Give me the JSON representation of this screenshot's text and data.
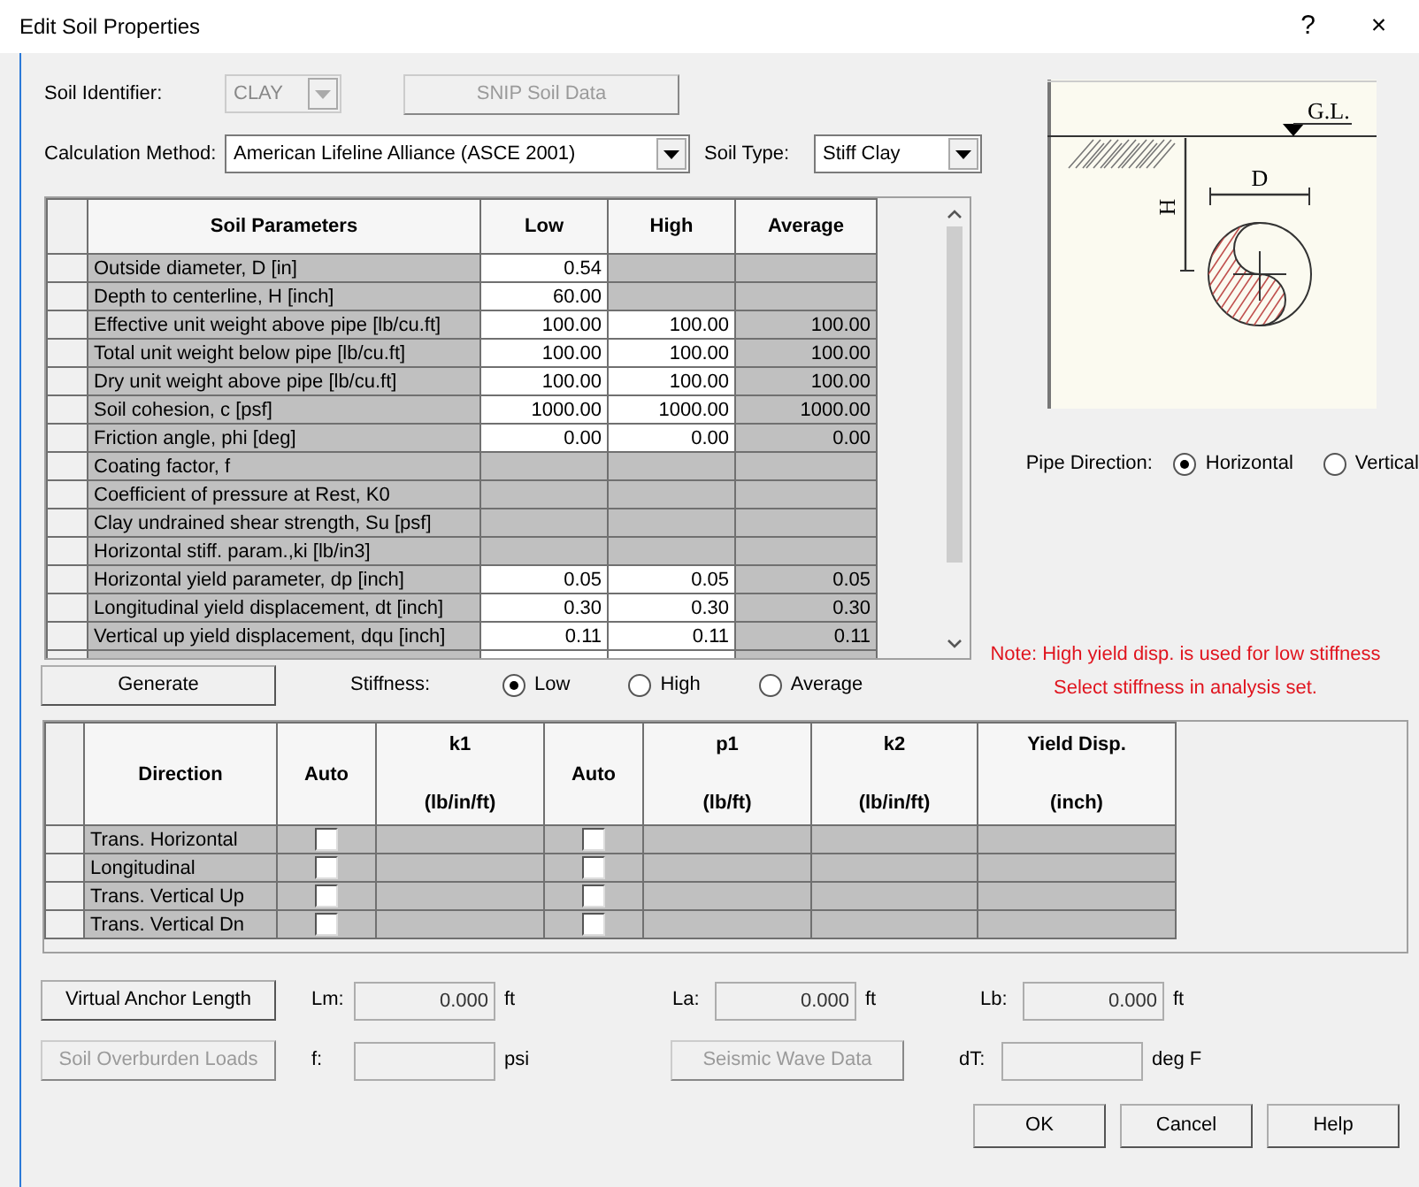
{
  "window": {
    "title": "Edit Soil Properties",
    "help_button": "?",
    "close_button": "×"
  },
  "soil_identifier": {
    "label": "Soil Identifier:",
    "value": "CLAY",
    "disabled": true
  },
  "snip_button": {
    "label": "SNIP Soil Data",
    "disabled": true
  },
  "calculation_method": {
    "label": "Calculation Method:",
    "value": "American Lifeline Alliance (ASCE 2001)"
  },
  "soil_type": {
    "label": "Soil Type:",
    "value": "Stiff Clay"
  },
  "soil_table": {
    "columns": [
      "Soil Parameters",
      "Low",
      "High",
      "Average"
    ],
    "rows": [
      {
        "cells": [
          {
            "value": "Outside diameter, D  [in]",
            "editable": false
          },
          {
            "value": "0.54",
            "editable": true
          },
          {
            "editable": false
          },
          {
            "editable": false
          }
        ]
      },
      {
        "cells": [
          {
            "value": "Depth to centerline, H  [inch]",
            "editable": false
          },
          {
            "value": "60.00",
            "editable": true
          },
          {
            "editable": false
          },
          {
            "editable": false
          }
        ]
      },
      {
        "cells": [
          {
            "value": "Effective unit weight above pipe  [lb/cu.ft]",
            "editable": false
          },
          {
            "value": "100.00",
            "editable": true
          },
          {
            "value": "100.00",
            "editable": true
          },
          {
            "value": "100.00",
            "editable": false
          }
        ]
      },
      {
        "cells": [
          {
            "value": "Total unit weight below pipe  [lb/cu.ft]",
            "editable": false
          },
          {
            "value": "100.00",
            "editable": true
          },
          {
            "value": "100.00",
            "editable": true
          },
          {
            "value": "100.00",
            "editable": false
          }
        ]
      },
      {
        "cells": [
          {
            "value": "Dry unit weight above pipe  [lb/cu.ft]",
            "editable": false
          },
          {
            "value": "100.00",
            "editable": true
          },
          {
            "value": "100.00",
            "editable": true
          },
          {
            "value": "100.00",
            "editable": false
          }
        ]
      },
      {
        "cells": [
          {
            "value": "Soil cohesion, c  [psf]",
            "editable": false
          },
          {
            "value": "1000.00",
            "editable": true
          },
          {
            "value": "1000.00",
            "editable": true
          },
          {
            "value": "1000.00",
            "editable": false
          }
        ]
      },
      {
        "cells": [
          {
            "value": "Friction angle, phi  [deg]",
            "editable": false
          },
          {
            "value": "0.00",
            "editable": true
          },
          {
            "value": "0.00",
            "editable": true
          },
          {
            "value": "0.00",
            "editable": false
          }
        ]
      },
      {
        "cells": [
          {
            "value": "Coating factor, f",
            "editable": false
          },
          {
            "editable": false
          },
          {
            "editable": false
          },
          {
            "editable": false
          }
        ]
      },
      {
        "cells": [
          {
            "value": "Coefficient of pressure at Rest, K0",
            "editable": false
          },
          {
            "editable": false
          },
          {
            "editable": false
          },
          {
            "editable": false
          }
        ]
      },
      {
        "cells": [
          {
            "value": "Clay undrained shear strength, Su  [psf]",
            "editable": false
          },
          {
            "editable": false
          },
          {
            "editable": false
          },
          {
            "editable": false
          }
        ]
      },
      {
        "cells": [
          {
            "value": "Horizontal stiff. param.,ki [lb/in3]",
            "editable": false
          },
          {
            "editable": false
          },
          {
            "editable": false
          },
          {
            "editable": false
          }
        ]
      },
      {
        "cells": [
          {
            "value": "Horizontal yield parameter, dp  [inch]",
            "editable": false
          },
          {
            "value": "0.05",
            "editable": true
          },
          {
            "value": "0.05",
            "editable": true
          },
          {
            "value": "0.05",
            "editable": false
          }
        ]
      },
      {
        "cells": [
          {
            "value": "Longitudinal yield displacement, dt [inch]",
            "editable": false
          },
          {
            "value": "0.30",
            "editable": true
          },
          {
            "value": "0.30",
            "editable": true
          },
          {
            "value": "0.30",
            "editable": false
          }
        ]
      },
      {
        "cells": [
          {
            "value": "Vertical up yield displacement, dqu [inch]",
            "editable": false
          },
          {
            "value": "0.11",
            "editable": true
          },
          {
            "value": "0.11",
            "editable": true
          },
          {
            "value": "0.11",
            "editable": false
          }
        ]
      }
    ]
  },
  "diagram": {
    "ground_label": "G.L.",
    "diameter_label": "D",
    "depth_label": "H"
  },
  "pipe_direction": {
    "label": "Pipe Direction:",
    "options": [
      {
        "label": "Horizontal",
        "selected": true
      },
      {
        "label": "Vertical",
        "selected": false
      }
    ]
  },
  "note": [
    "Note: High yield disp. is used for low stiffness",
    "Select stiffness in analysis set."
  ],
  "generate_button": "Generate",
  "stiffness": {
    "label": "Stiffness:",
    "options": [
      {
        "label": "Low",
        "selected": true
      },
      {
        "label": "High",
        "selected": false
      },
      {
        "label": "Average",
        "selected": false
      }
    ]
  },
  "spring_table": {
    "columns": [
      {
        "title": "Direction"
      },
      {
        "title": "Auto"
      },
      {
        "title": "k1",
        "unit": "(lb/in/ft)"
      },
      {
        "title": "Auto"
      },
      {
        "title": "p1",
        "unit": "(lb/ft)"
      },
      {
        "title": "k2",
        "unit": "(lb/in/ft)"
      },
      {
        "title": "Yield Disp.",
        "unit": "(inch)"
      }
    ],
    "rows": [
      {
        "direction": "Trans. Horizontal",
        "auto_k1": false,
        "auto_p1": false
      },
      {
        "direction": "Longitudinal",
        "auto_k1": false,
        "auto_p1": false
      },
      {
        "direction": "Trans. Vertical Up",
        "auto_k1": false,
        "auto_p1": false
      },
      {
        "direction": "Trans. Vertical Dn",
        "auto_k1": false,
        "auto_p1": false
      }
    ]
  },
  "bottom_rows": [
    [
      {
        "kind": "button",
        "label": "Virtual Anchor Length",
        "disabled": false
      },
      {
        "kind": "field",
        "label": "Lm:",
        "value": "0.000",
        "unit": "ft"
      },
      {
        "kind": "field",
        "label": "La:",
        "value": "0.000",
        "unit": "ft"
      },
      {
        "kind": "field",
        "label": "Lb:",
        "value": "0.000",
        "unit": "ft"
      }
    ],
    [
      {
        "kind": "button",
        "label": "Soil Overburden Loads",
        "disabled": true
      },
      {
        "kind": "field",
        "label": "f:",
        "unit": "psi"
      },
      {
        "kind": "button",
        "label": "Seismic Wave Data",
        "disabled": true
      },
      {
        "kind": "field",
        "label": "dT:",
        "unit": "deg F"
      }
    ]
  ],
  "buttons": [
    "OK",
    "Cancel",
    "Help"
  ]
}
